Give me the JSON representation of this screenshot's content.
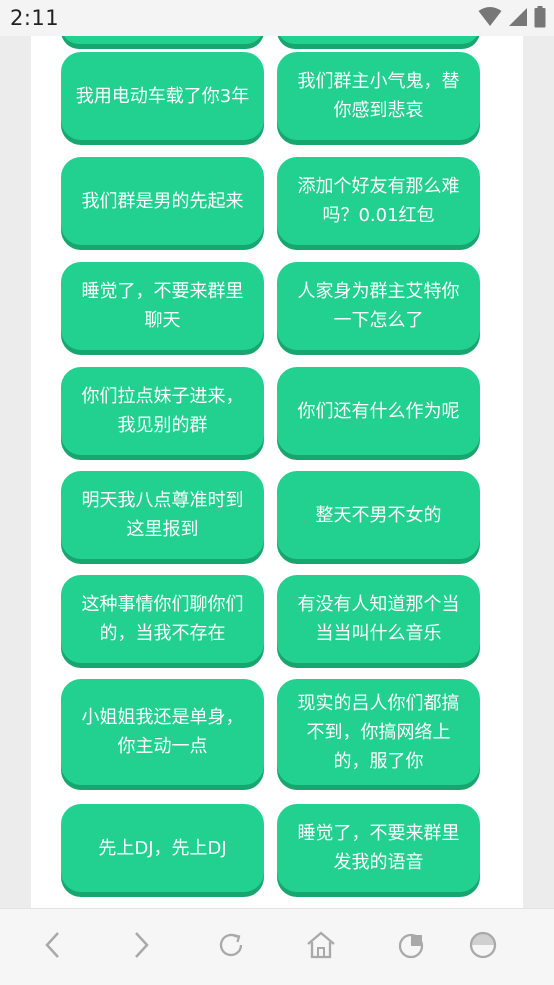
{
  "status_bar": {
    "time": "2:11"
  },
  "grid": {
    "tiles": [
      "我用电动车载了你3年",
      "我们群主小气鬼，替你感到悲哀",
      "我们群是男的先起来",
      "添加个好友有那么难吗？0.01红包",
      "睡觉了，不要来群里聊天",
      "人家身为群主艾特你一下怎么了",
      "你们拉点妹子进来，我见别的群",
      "你们还有什么作为呢",
      "明天我八点尊准时到这里报到",
      "整天不男不女的",
      "这种事情你们聊你们的，当我不存在",
      "有没有人知道那个当当当叫什么音乐",
      "小姐姐我还是单身，你主动一点",
      "现实的吕人你们都搞不到，你搞网络上的，服了你",
      "先上DJ，先上DJ",
      "睡觉了，不要来群里发我的语音"
    ]
  },
  "colors": {
    "tile": "#22d08f",
    "tile_shadow": "#19a56f",
    "icon": "#a9a9a9"
  },
  "bottom_nav": {
    "icons": [
      "back-icon",
      "forward-icon",
      "refresh-icon",
      "home-icon",
      "tabs-icon",
      "menu-icon"
    ]
  }
}
